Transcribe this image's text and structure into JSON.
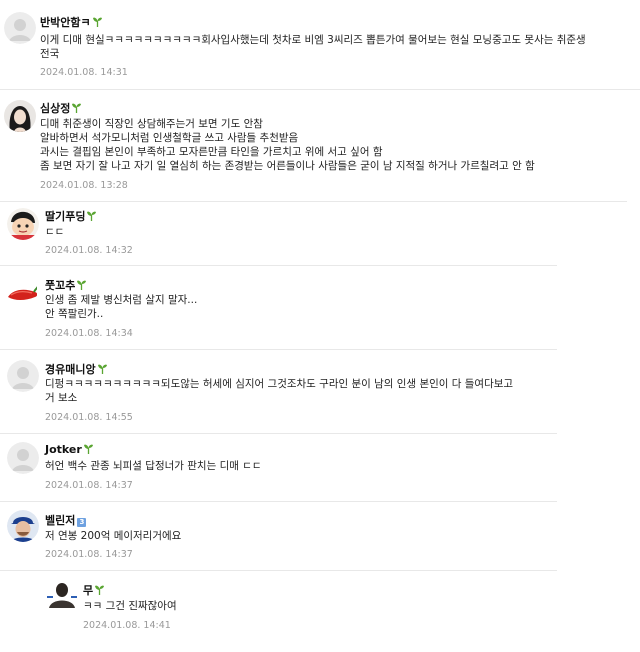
{
  "comments": [
    {
      "nick": "반박안함ㅋ",
      "body": "이게 디매 현실ㅋㅋㅋㅋㅋㅋㅋㅋㅋㅋ회사입사했는데 첫차로 비엠 3씨리즈 뽑튼가여 물어보는 현실 모닝중고도 못사는 취준생\n전국",
      "date": "2024.01.08. 14:31"
    },
    {
      "nick": "심상정",
      "body": "디매 취준생이 직장인 상담해주는거 보면 기도 안참\n알바하면서 석가모니처럼 인생철학글 쓰고 사람들 추천받음\n과시는 결핍임 본인이 부족하고 모자른만큼 타인을 가르치고 위에 서고 싶어 함\n좀 보면 자기 잘 나고 자기 일 열심히 하는 존경받는 어른들이나 사람들은 굳이 남 지적질 하거나 가르칠려고 안 함",
      "date": "2024.01.08. 13:28"
    },
    {
      "nick": "딸기푸딩",
      "body": "ㄷㄷ",
      "date": "2024.01.08. 14:32"
    },
    {
      "nick": "풋꼬추",
      "body": "인생 좀 제발 병신처럼 살지 말자...\n안 쪽팔린가..",
      "date": "2024.01.08. 14:34"
    },
    {
      "nick": "경유매니앙",
      "body": "디펑ㅋㅋㅋㅋㅋㅋㅋㅋㅋㅋ되도않는 허세에 심지어 그것조차도 구라인 분이 남의 인생 본인이 다 들여다보고\n거 보소",
      "date": "2024.01.08. 14:55"
    },
    {
      "nick": "Jotker",
      "body": "허언 백수 관종 뇌피셜 답정너가 판치는 디매 ㄷㄷ",
      "date": "2024.01.08. 14:37"
    },
    {
      "nick": "벨린저",
      "badge": "3",
      "body": "저 연봉 200억 메이저리거에요",
      "date": "2024.01.08. 14:37"
    },
    {
      "nick": "무",
      "body": "ㅋㅋ 그건 진짜잖아여",
      "date": "2024.01.08. 14:41"
    }
  ],
  "colors": {
    "date": "#999999",
    "sprout": "#5aa532",
    "badge": "#6ea1e0",
    "divider": "#e8e8e8"
  },
  "icons": [
    "default-profile-icon",
    "woman-portrait",
    "cartoon-character",
    "red-chili-pepper",
    "baseball-player",
    "dark-silhouette",
    "sprout-icon",
    "level-badge-icon"
  ]
}
